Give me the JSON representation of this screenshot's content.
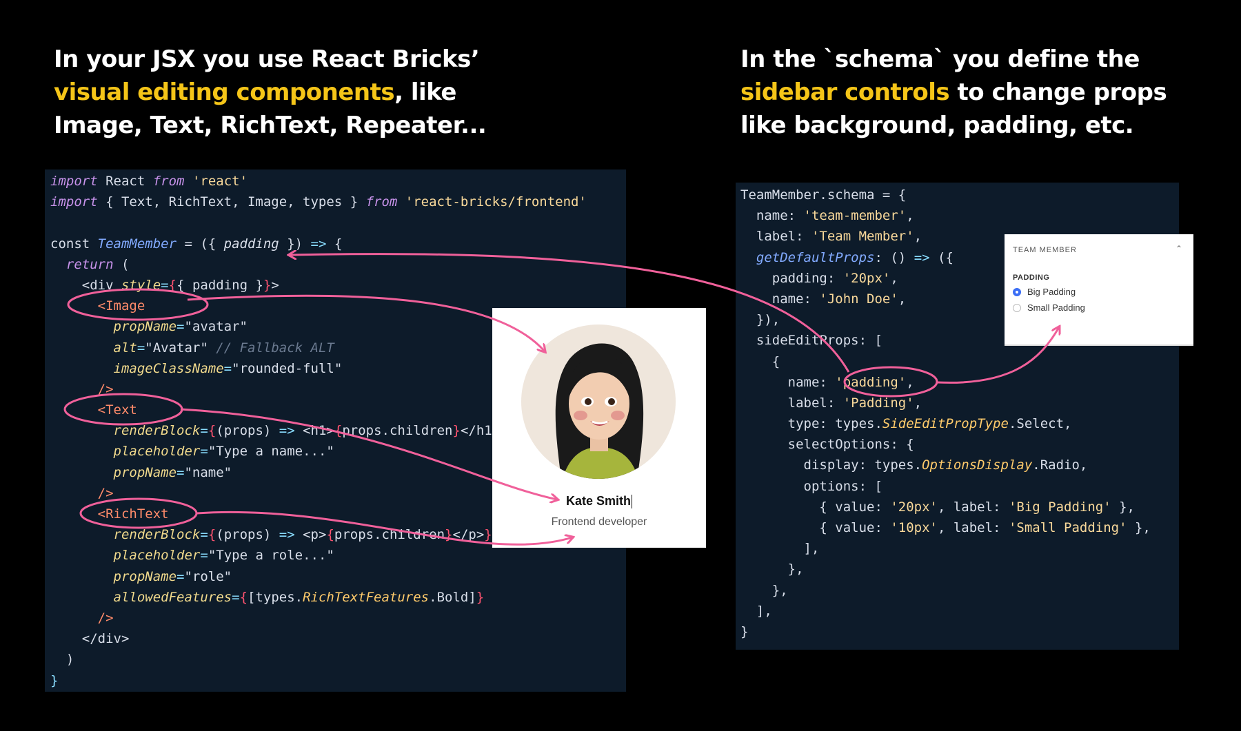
{
  "headings": {
    "left": {
      "line1": "In your JSX you use React Bricks’",
      "line2_highlight": "visual editing components",
      "line2_rest": ", like",
      "line3": "Image, Text, RichText, Repeater..."
    },
    "right": {
      "line1": "In the `schema` you define the",
      "line2_highlight": "sidebar controls",
      "line2_rest": " to change props",
      "line3": "like background, padding, etc."
    }
  },
  "left_code": [
    [
      [
        "kw",
        "import"
      ],
      [
        "plain",
        " React "
      ],
      [
        "kw",
        "from"
      ],
      [
        "plain",
        " "
      ],
      [
        "str",
        "'react'"
      ]
    ],
    [
      [
        "kw",
        "import"
      ],
      [
        "plain",
        " { Text, RichText, Image, types } "
      ],
      [
        "kw",
        "from"
      ],
      [
        "plain",
        " "
      ],
      [
        "str",
        "'react-bricks/frontend'"
      ]
    ],
    [],
    [
      [
        "plain",
        "const "
      ],
      [
        "fn",
        "TeamMember"
      ],
      [
        "plain",
        " = ({ "
      ],
      [
        "par",
        "padding"
      ],
      [
        "plain",
        " }) "
      ],
      [
        "punc",
        "=>"
      ],
      [
        "plain",
        " {"
      ]
    ],
    [
      [
        "ind",
        ""
      ],
      [
        "kw",
        "  return"
      ],
      [
        "plain",
        " ("
      ]
    ],
    [
      [
        "ind",
        ""
      ],
      [
        "plain",
        "    "
      ],
      [
        "ind",
        ""
      ],
      [
        "plain",
        "<div "
      ],
      [
        "attr",
        "style"
      ],
      [
        "punc",
        "="
      ],
      [
        "brace",
        "{"
      ],
      [
        "plain",
        "{ padding }"
      ],
      [
        "brace",
        "}"
      ],
      [
        "plain",
        ">"
      ]
    ],
    [
      [
        "plain",
        "      "
      ],
      [
        "tag",
        "<Image"
      ]
    ],
    [
      [
        "plain",
        "        "
      ],
      [
        "attr",
        "propName"
      ],
      [
        "punc",
        "="
      ],
      [
        "plain",
        "\"avatar\""
      ]
    ],
    [
      [
        "plain",
        "        "
      ],
      [
        "attr",
        "alt"
      ],
      [
        "punc",
        "="
      ],
      [
        "plain",
        "\"Avatar\" "
      ],
      [
        "cmt",
        "// Fallback ALT"
      ]
    ],
    [
      [
        "plain",
        "        "
      ],
      [
        "attr",
        "imageClassName"
      ],
      [
        "punc",
        "="
      ],
      [
        "plain",
        "\"rounded-full\""
      ]
    ],
    [
      [
        "plain",
        "      "
      ],
      [
        "tag",
        "/>"
      ]
    ],
    [
      [
        "plain",
        "      "
      ],
      [
        "tag",
        "<Text"
      ]
    ],
    [
      [
        "plain",
        "        "
      ],
      [
        "attr",
        "renderBlock"
      ],
      [
        "punc",
        "="
      ],
      [
        "brace",
        "{"
      ],
      [
        "plain",
        "(props) "
      ],
      [
        "punc",
        "=>"
      ],
      [
        "plain",
        " <h1>"
      ],
      [
        "brace",
        "{"
      ],
      [
        "plain",
        "props.children"
      ],
      [
        "brace",
        "}"
      ],
      [
        "plain",
        "</h1>"
      ],
      [
        "brace",
        "}"
      ]
    ],
    [
      [
        "plain",
        "        "
      ],
      [
        "attr",
        "placeholder"
      ],
      [
        "punc",
        "="
      ],
      [
        "plain",
        "\"Type a name...\""
      ]
    ],
    [
      [
        "plain",
        "        "
      ],
      [
        "attr",
        "propName"
      ],
      [
        "punc",
        "="
      ],
      [
        "plain",
        "\"name\""
      ]
    ],
    [
      [
        "plain",
        "      "
      ],
      [
        "tag",
        "/>"
      ]
    ],
    [
      [
        "plain",
        "      "
      ],
      [
        "tag",
        "<RichText"
      ]
    ],
    [
      [
        "plain",
        "        "
      ],
      [
        "attr",
        "renderBlock"
      ],
      [
        "punc",
        "="
      ],
      [
        "brace",
        "{"
      ],
      [
        "plain",
        "(props) "
      ],
      [
        "punc",
        "=>"
      ],
      [
        "plain",
        " <p>"
      ],
      [
        "brace",
        "{"
      ],
      [
        "plain",
        "props.children"
      ],
      [
        "brace",
        "}"
      ],
      [
        "plain",
        "</p>"
      ],
      [
        "brace",
        "}"
      ]
    ],
    [
      [
        "plain",
        "        "
      ],
      [
        "attr",
        "placeholder"
      ],
      [
        "punc",
        "="
      ],
      [
        "plain",
        "\"Type a role...\""
      ]
    ],
    [
      [
        "plain",
        "        "
      ],
      [
        "attr",
        "propName"
      ],
      [
        "punc",
        "="
      ],
      [
        "plain",
        "\"role\""
      ]
    ],
    [
      [
        "plain",
        "        "
      ],
      [
        "attr",
        "allowedFeatures"
      ],
      [
        "punc",
        "="
      ],
      [
        "brace",
        "{"
      ],
      [
        "plain",
        "[types."
      ],
      [
        "cls",
        "RichTextFeatures"
      ],
      [
        "plain",
        ".Bold]"
      ],
      [
        "brace",
        "}"
      ]
    ],
    [
      [
        "plain",
        "      "
      ],
      [
        "tag",
        "/>"
      ]
    ],
    [
      [
        "plain",
        "    </div>"
      ]
    ],
    [
      [
        "plain",
        "  )"
      ]
    ],
    [
      [
        "punc",
        "}"
      ]
    ]
  ],
  "right_code": [
    [
      [
        "plain",
        "TeamMember.schema = {"
      ]
    ],
    [
      [
        "plain",
        "  name: "
      ],
      [
        "str",
        "'team-member'"
      ],
      [
        "plain",
        ","
      ]
    ],
    [
      [
        "plain",
        "  label: "
      ],
      [
        "str",
        "'Team Member'"
      ],
      [
        "plain",
        ","
      ]
    ],
    [
      [
        "plain",
        "  "
      ],
      [
        "fn",
        "getDefaultProps"
      ],
      [
        "plain",
        ": () "
      ],
      [
        "punc",
        "=>"
      ],
      [
        "plain",
        " ({"
      ]
    ],
    [
      [
        "plain",
        "    padding: "
      ],
      [
        "str",
        "'20px'"
      ],
      [
        "plain",
        ","
      ]
    ],
    [
      [
        "plain",
        "    name: "
      ],
      [
        "str",
        "'John Doe'"
      ],
      [
        "plain",
        ","
      ]
    ],
    [
      [
        "plain",
        "  }),"
      ]
    ],
    [
      [
        "plain",
        "  sideEditProps: ["
      ]
    ],
    [
      [
        "plain",
        "    {"
      ]
    ],
    [
      [
        "plain",
        "      name: "
      ],
      [
        "str",
        "'padding'"
      ],
      [
        "plain",
        ","
      ]
    ],
    [
      [
        "plain",
        "      label: "
      ],
      [
        "str",
        "'Padding'"
      ],
      [
        "plain",
        ","
      ]
    ],
    [
      [
        "plain",
        "      type: types."
      ],
      [
        "cls",
        "SideEditPropType"
      ],
      [
        "plain",
        ".Select,"
      ]
    ],
    [
      [
        "plain",
        "      selectOptions: {"
      ]
    ],
    [
      [
        "plain",
        "        display: types."
      ],
      [
        "cls",
        "OptionsDisplay"
      ],
      [
        "plain",
        ".Radio,"
      ]
    ],
    [
      [
        "plain",
        "        options: ["
      ]
    ],
    [
      [
        "plain",
        "          { value: "
      ],
      [
        "str",
        "'20px'"
      ],
      [
        "plain",
        ", label: "
      ],
      [
        "str",
        "'Big Padding'"
      ],
      [
        "plain",
        " },"
      ]
    ],
    [
      [
        "plain",
        "          { value: "
      ],
      [
        "str",
        "'10px'"
      ],
      [
        "plain",
        ", label: "
      ],
      [
        "str",
        "'Small Padding'"
      ],
      [
        "plain",
        " },"
      ]
    ],
    [
      [
        "plain",
        "        ],"
      ]
    ],
    [
      [
        "plain",
        "      },"
      ]
    ],
    [
      [
        "plain",
        "    },"
      ]
    ],
    [
      [
        "plain",
        "  ],"
      ]
    ],
    [
      [
        "plain",
        "}"
      ]
    ]
  ],
  "preview_card": {
    "name": "Kate Smith",
    "role": "Frontend developer"
  },
  "sidebar": {
    "title": "TEAM MEMBER",
    "chevron_icon": "chevron-up-icon",
    "label": "PADDING",
    "options": [
      {
        "label": "Big Padding",
        "selected": true
      },
      {
        "label": "Small Padding",
        "selected": false
      }
    ]
  },
  "colors": {
    "highlight": "#f5c518",
    "arrow": "#f0609a",
    "code_bg": "#0d1b2a",
    "radio_accent": "#3b6ef5"
  }
}
